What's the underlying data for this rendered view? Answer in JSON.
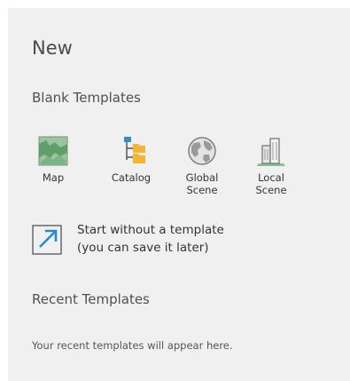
{
  "panel": {
    "title": "New",
    "blank_templates_heading": "Blank Templates",
    "templates": [
      {
        "label": "Map",
        "icon": "map-icon"
      },
      {
        "label": "Catalog",
        "icon": "catalog-icon"
      },
      {
        "label": "Global\nScene",
        "icon": "globe-icon"
      },
      {
        "label": "Local\nScene",
        "icon": "buildings-icon"
      }
    ],
    "start_without": {
      "line1": "Start without a template",
      "line2": "(you can save it later)",
      "icon": "open-arrow-icon"
    },
    "recent_templates_heading": "Recent Templates",
    "recent_empty_text": "Your recent templates will appear here."
  },
  "colors": {
    "panel_bg": "#f0f0f0",
    "accent_blue": "#1f8dd6"
  }
}
